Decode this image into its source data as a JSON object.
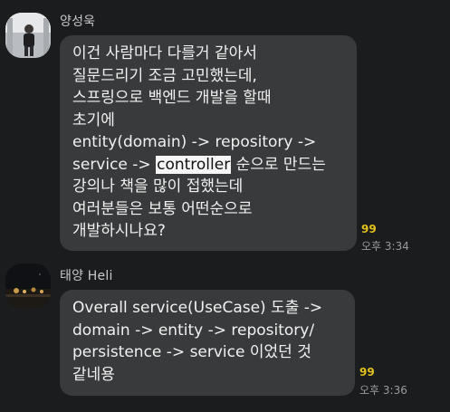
{
  "messages": [
    {
      "sender": "양성욱",
      "avatar": "profile-photo-person",
      "text_before": [
        "이건 사람마다 다를거 같아서",
        "질문드리기 조금 고민했는데,",
        "스프링으로 백엔드 개발을 할때",
        "초기에",
        "entity(domain) -> repository ->"
      ],
      "line6_prefix": "service -> ",
      "highlight": "controller",
      "line6_suffix": " 순으로 만드는",
      "text_after": [
        "강의나 책을 많이 접했는데",
        "여러분들은 보통 어떤순으로",
        "개발하시나요?"
      ],
      "unread_count": "99",
      "time": "오후 3:34"
    },
    {
      "sender": "태양 Heli",
      "avatar": "profile-photo-night",
      "lines": [
        "Overall service(UseCase) 도출 ->",
        "domain -> entity -> repository/",
        "persistence -> service 이었던 것",
        "같네용"
      ],
      "unread_count": "99",
      "time": "오후 3:36"
    }
  ],
  "colors": {
    "background": "#1b1c1e",
    "bubble": "#393a3c",
    "unread": "#e2c21b",
    "highlight_bg": "#f6f6f6"
  }
}
